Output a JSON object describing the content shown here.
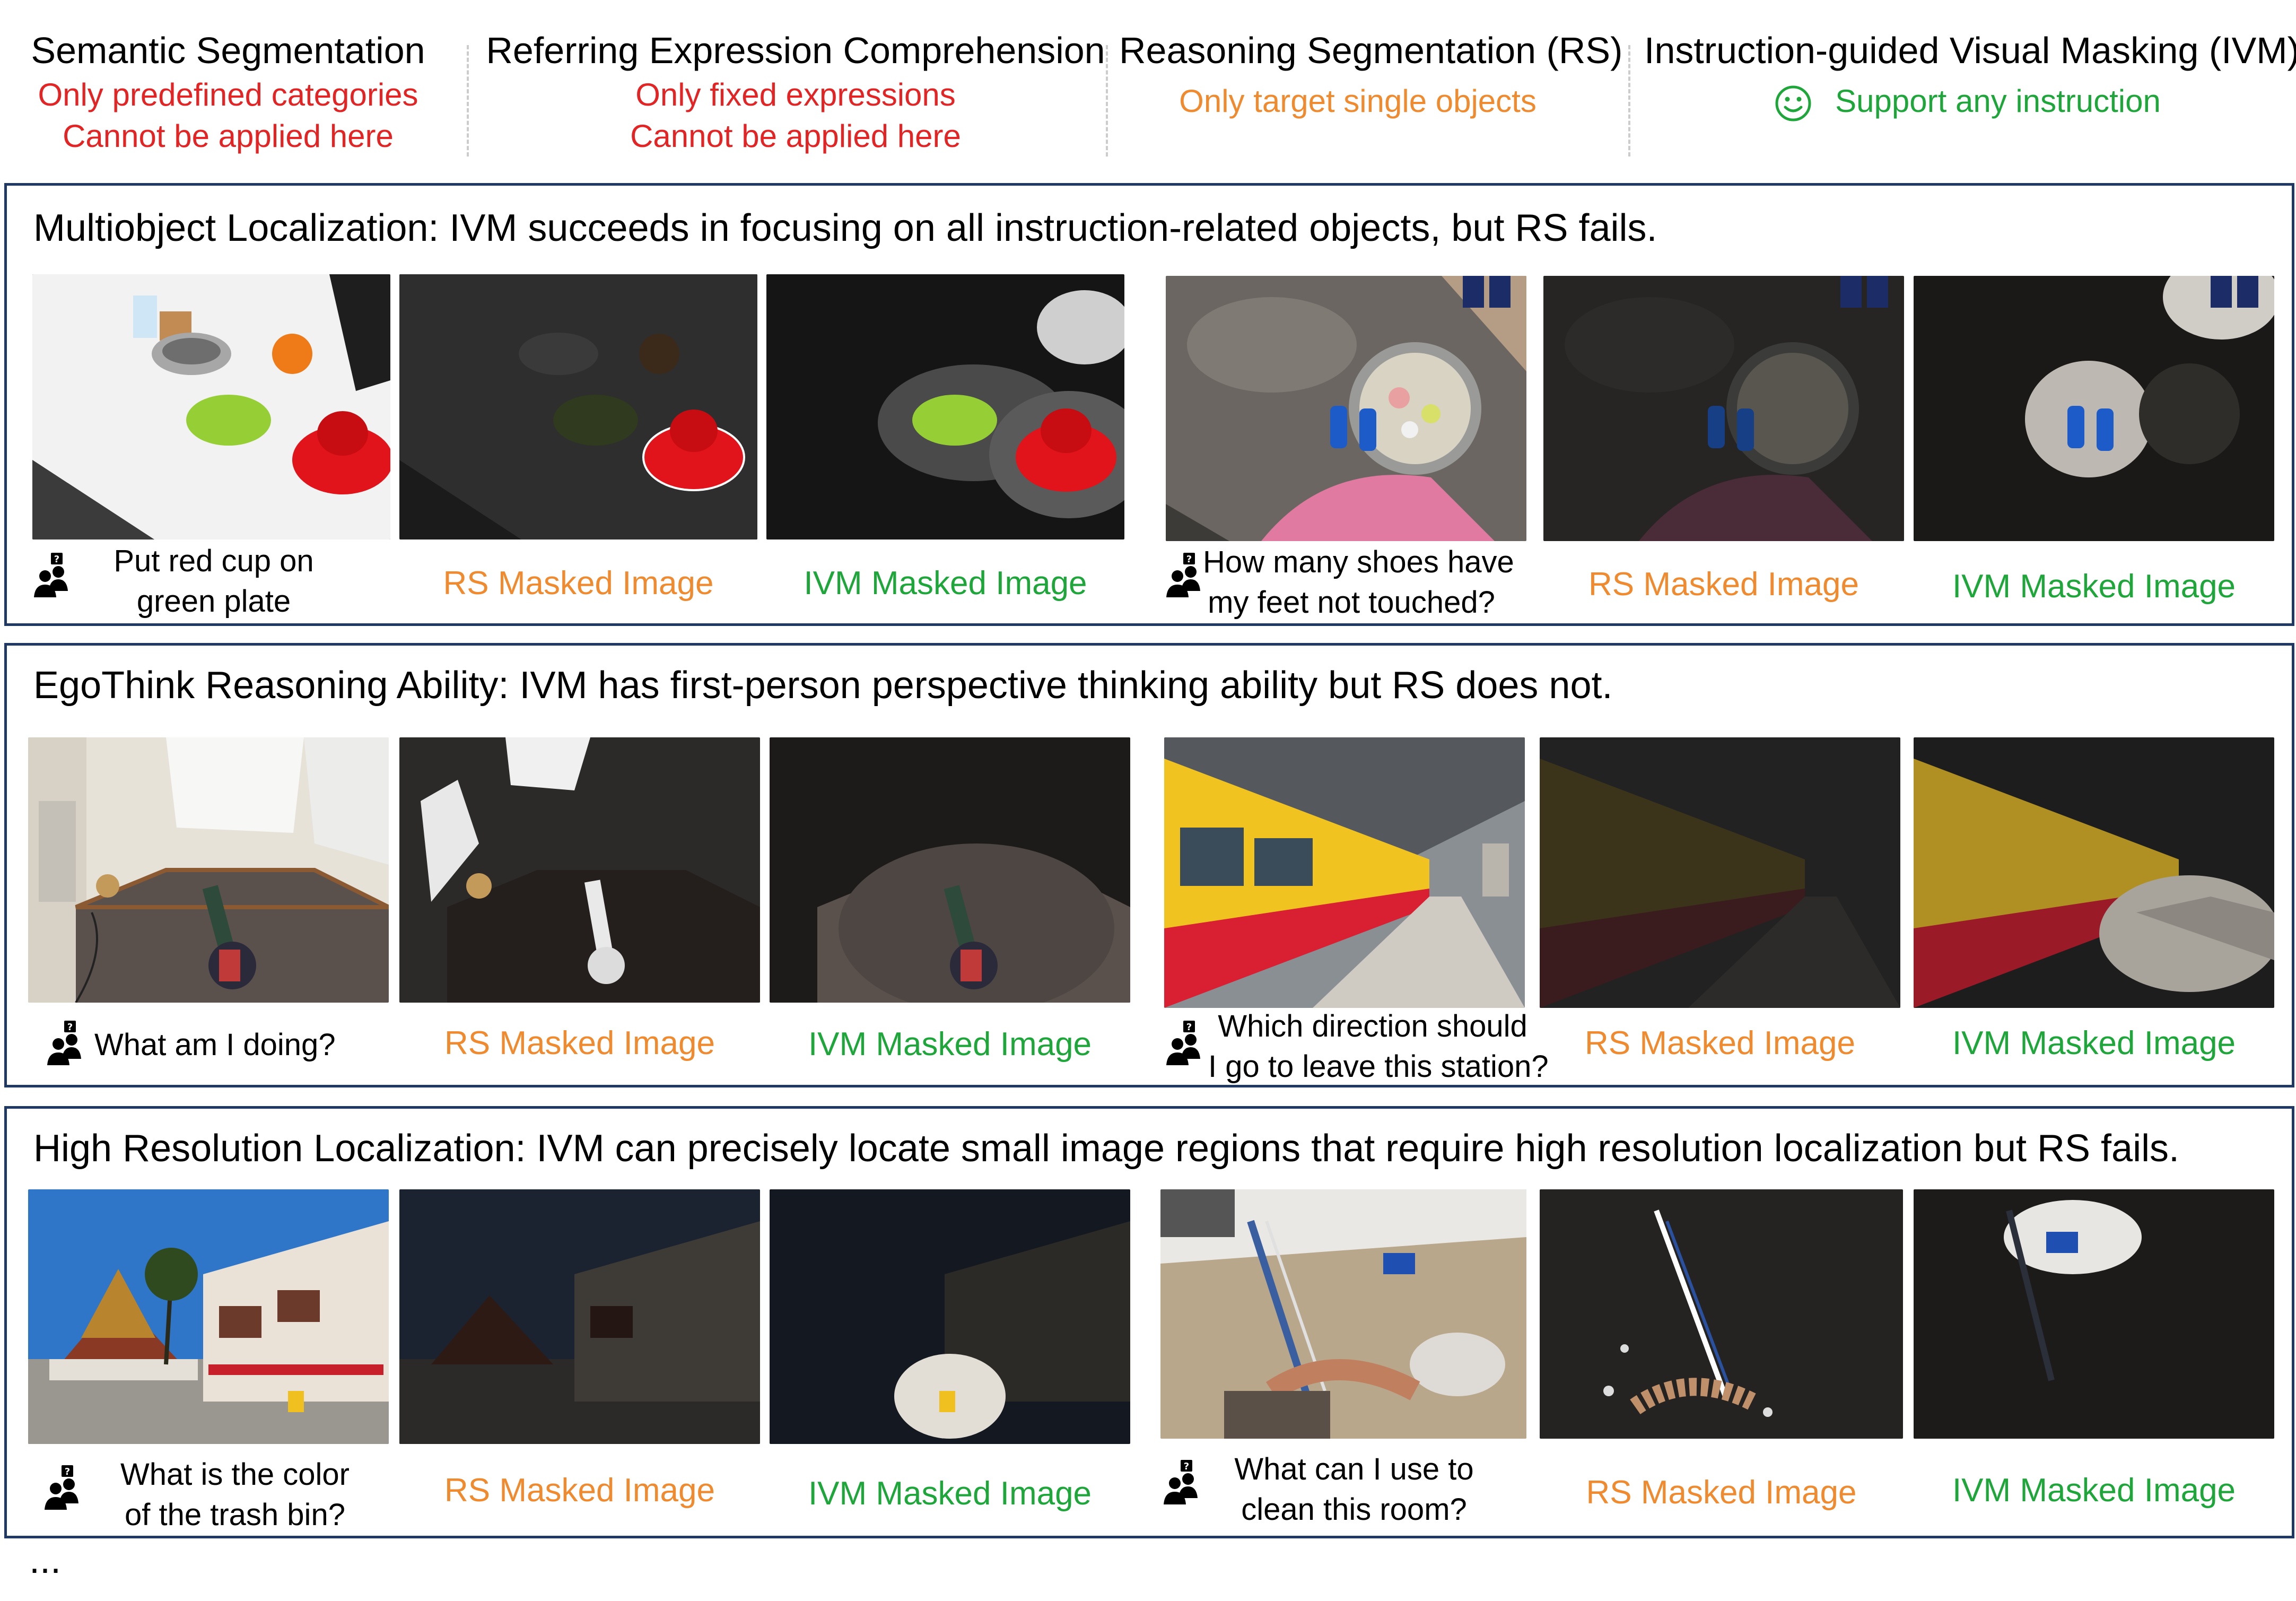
{
  "header": {
    "cols": [
      {
        "title": "Semantic Segmentation",
        "lines": [
          "Only predefined categories",
          "Cannot be applied here"
        ],
        "tone": "red"
      },
      {
        "title": "Referring Expression Comprehension",
        "lines": [
          "Only fixed expressions",
          "Cannot be applied here"
        ],
        "tone": "red"
      },
      {
        "title": "Reasoning Segmentation (RS)",
        "lines": [
          "Only target single objects"
        ],
        "tone": "orange"
      },
      {
        "title": "Instruction-guided Visual Masking (IVM)",
        "lines": [
          "Support any instruction"
        ],
        "tone": "green",
        "icon": "smiley-icon"
      }
    ]
  },
  "sections": [
    {
      "title": "Multiobject Localization: IVM succeeds in focusing on all instruction-related objects, but RS fails.",
      "examples": [
        {
          "question": [
            "Put red cup on",
            "green plate"
          ],
          "rs_label": "RS Masked Image",
          "ivm_label": "IVM Masked Image"
        },
        {
          "question": [
            "How many shoes have",
            "my feet not touched?"
          ],
          "rs_label": "RS Masked Image",
          "ivm_label": "IVM Masked Image"
        }
      ]
    },
    {
      "title": "EgoThink Reasoning Ability: IVM has first-person perspective thinking ability but RS does not.",
      "examples": [
        {
          "question": [
            "What am I doing?"
          ],
          "rs_label": "RS Masked Image",
          "ivm_label": "IVM Masked Image"
        },
        {
          "question": [
            "Which direction should",
            "I go to leave this station?"
          ],
          "rs_label": "RS Masked Image",
          "ivm_label": "IVM Masked Image"
        }
      ]
    },
    {
      "title": "High Resolution Localization: IVM can precisely locate small image regions that require high resolution localization but RS fails.",
      "examples": [
        {
          "question": [
            "What is the color",
            "of the trash bin?"
          ],
          "rs_label": "RS Masked Image",
          "ivm_label": "IVM Masked Image"
        },
        {
          "question": [
            "What can I use to",
            "clean this room?"
          ],
          "rs_label": "RS Masked Image",
          "ivm_label": "IVM Masked Image"
        }
      ]
    }
  ],
  "footer": {
    "ellipsis": "..."
  },
  "colors": {
    "red": "#e32424",
    "orange": "#ef8a2f",
    "green": "#1ea63b",
    "frame": "#1f3864"
  }
}
